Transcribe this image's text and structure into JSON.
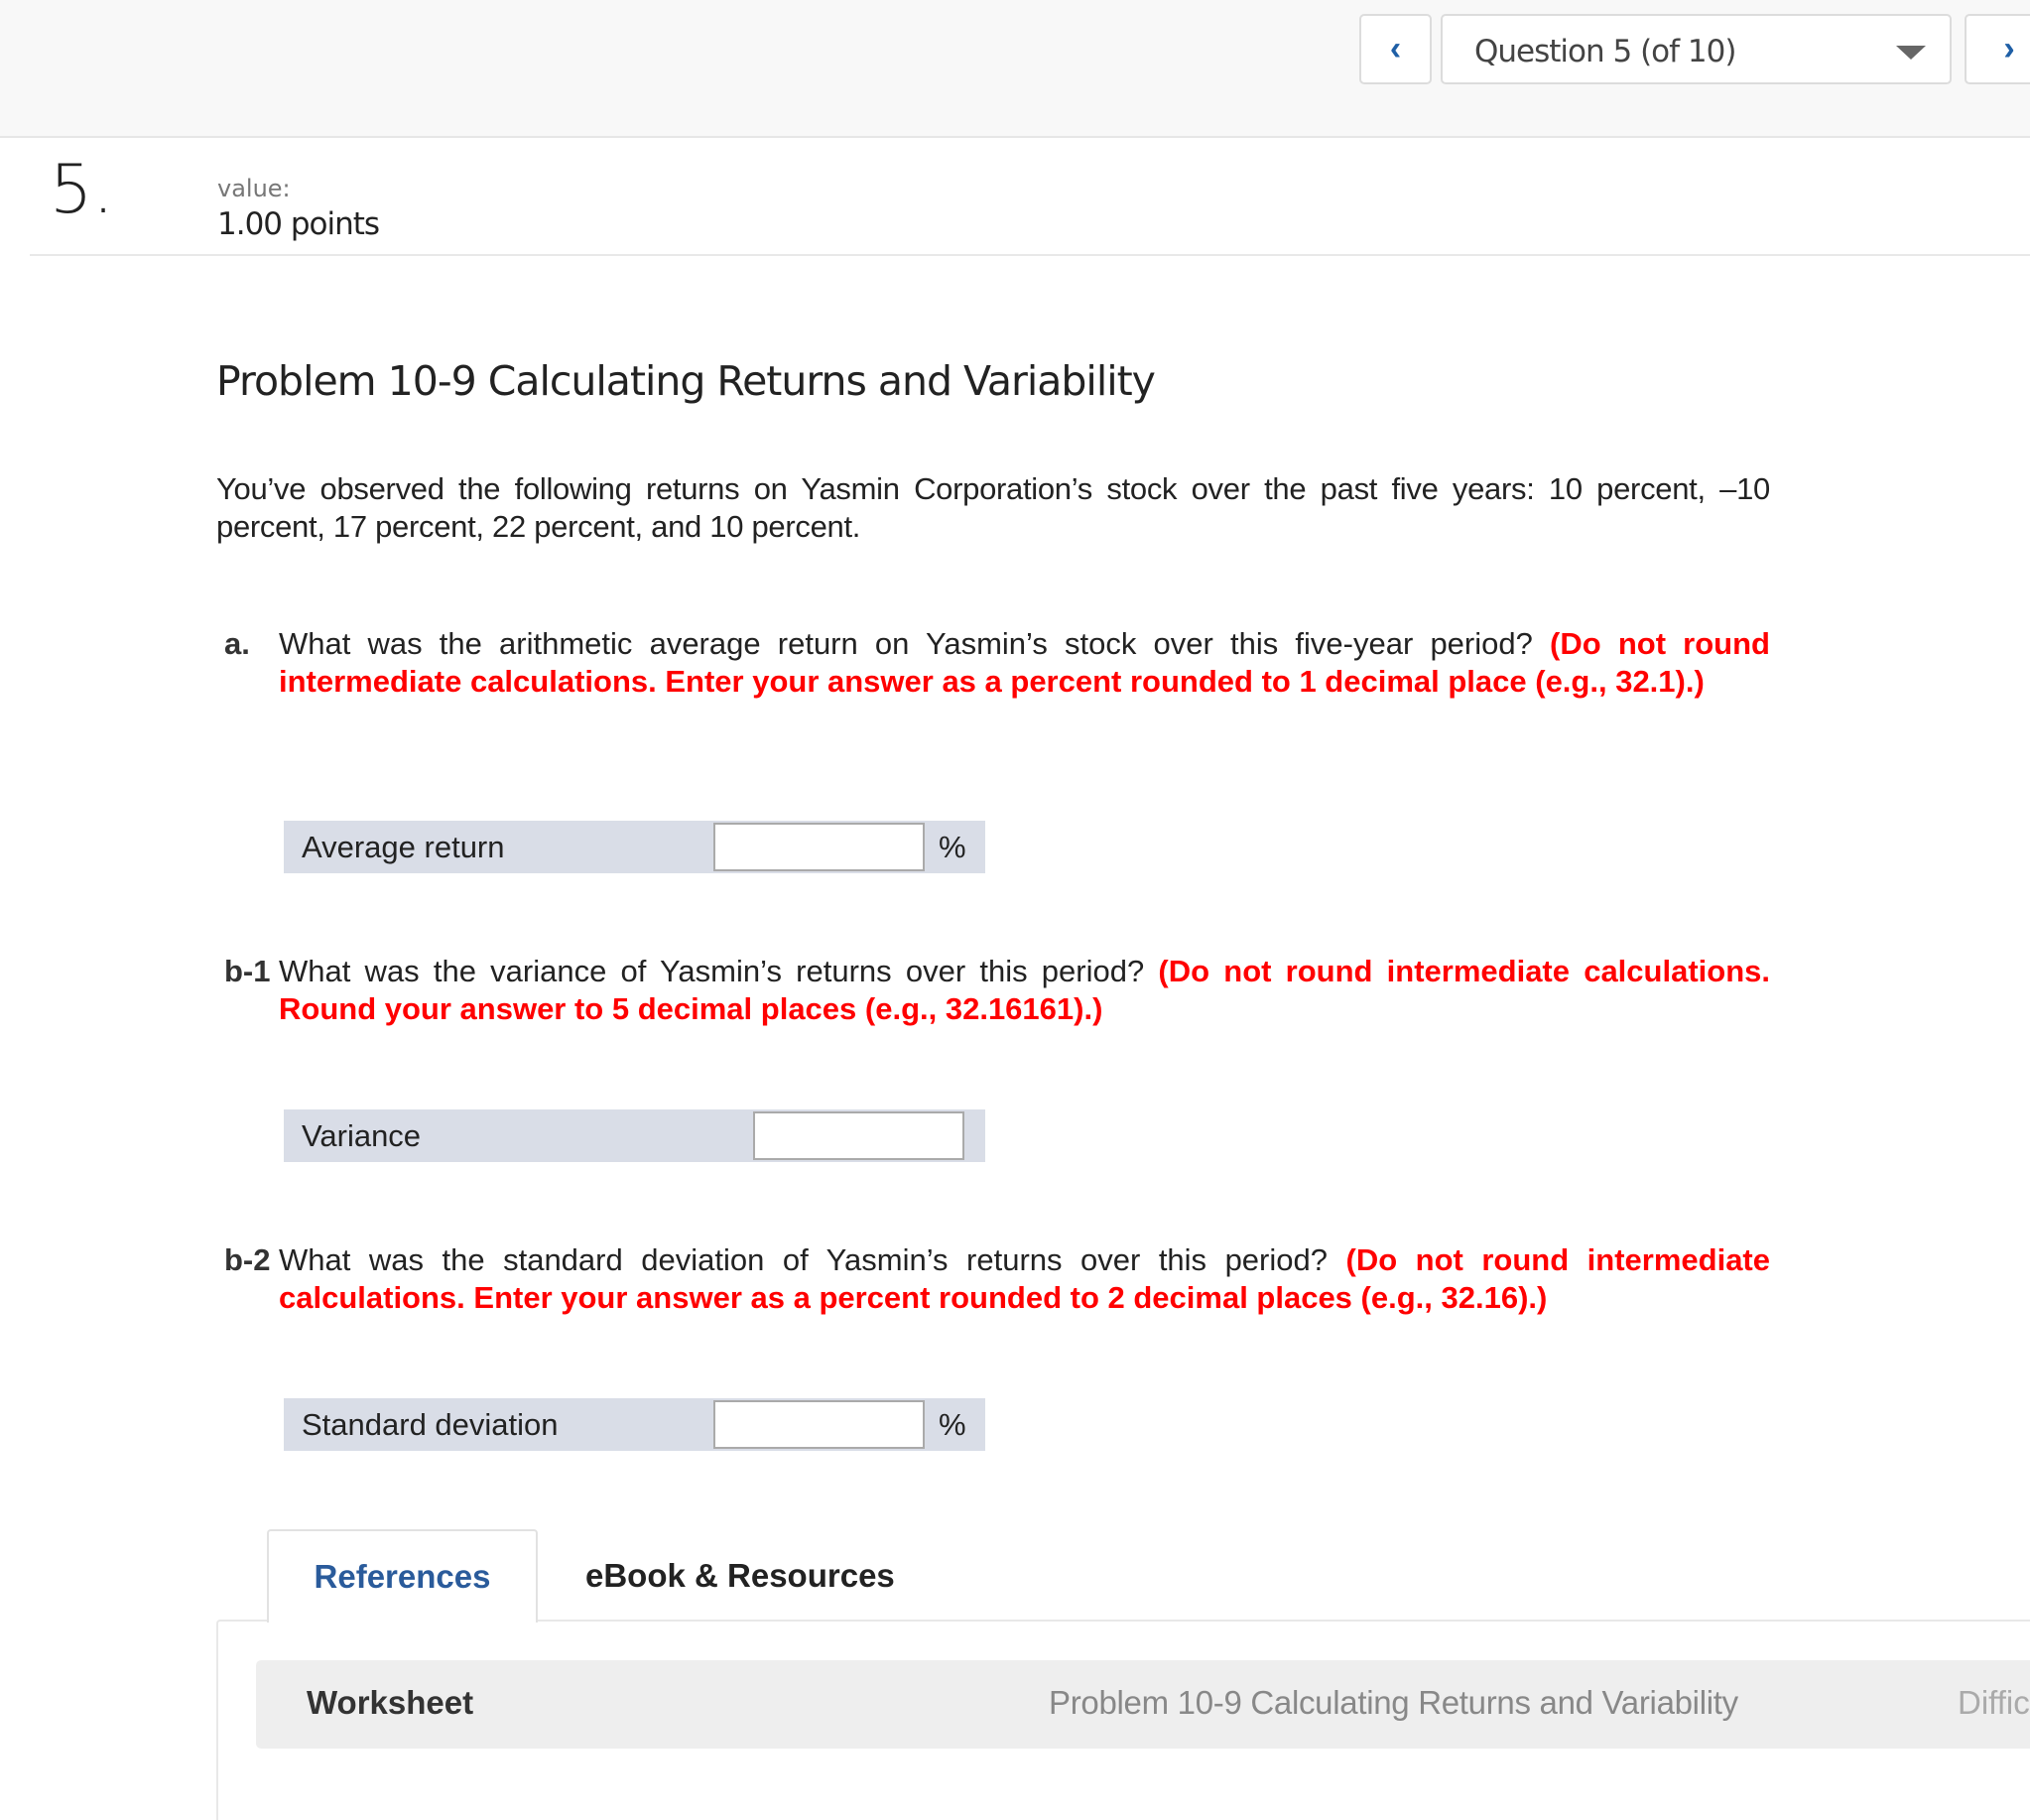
{
  "nav": {
    "prev_icon": "chevron-left-icon",
    "next_icon": "chevron-right-icon",
    "prev_glyph": "‹",
    "next_glyph": "›",
    "question_select": "Question 5 (of 10)"
  },
  "question": {
    "number": "5.",
    "value_label": "value:",
    "points": "1.00 points",
    "title": "Problem 10-9 Calculating Returns and Variability",
    "intro": "You’ve observed the following returns on Yasmin Corporation’s stock over the past five years: 10 percent, –10 percent, 17 percent, 22 percent, and 10 percent."
  },
  "parts": [
    {
      "label": "a.",
      "text": "What was the arithmetic average return on Yasmin’s stock over this five-year period? ",
      "instruction": "(Do not round intermediate calculations. Enter your answer as a percent rounded to 1 decimal place (e.g., 32.1).)",
      "field_label": "Average return",
      "value": "",
      "unit": "%"
    },
    {
      "label": "b-1",
      "text": "What was the variance of Yasmin’s returns over this period? ",
      "instruction": "(Do not round intermediate calculations. Round your answer to 5 decimal places (e.g., 32.16161).)",
      "field_label": "Variance",
      "value": "",
      "unit": ""
    },
    {
      "label": "b-2",
      "text": "What was the standard deviation of Yasmin’s returns over this period? ",
      "instruction": "(Do not round intermediate calculations. Enter your answer as a percent rounded to 2 decimal places (e.g., 32.16).)",
      "field_label": "Standard deviation",
      "value": "",
      "unit": "%"
    }
  ],
  "tabs": [
    {
      "label": "References",
      "active": true
    },
    {
      "label": "eBook & Resources",
      "active": false
    }
  ],
  "worksheet": {
    "label": "Worksheet",
    "title": "Problem 10-9 Calculating Returns and Variability",
    "difficulty_partial": "Diffic"
  },
  "colors": {
    "accent": "#1f5fa6",
    "instruction_red": "#ff0000",
    "input_row_bg": "#d9dde7"
  }
}
